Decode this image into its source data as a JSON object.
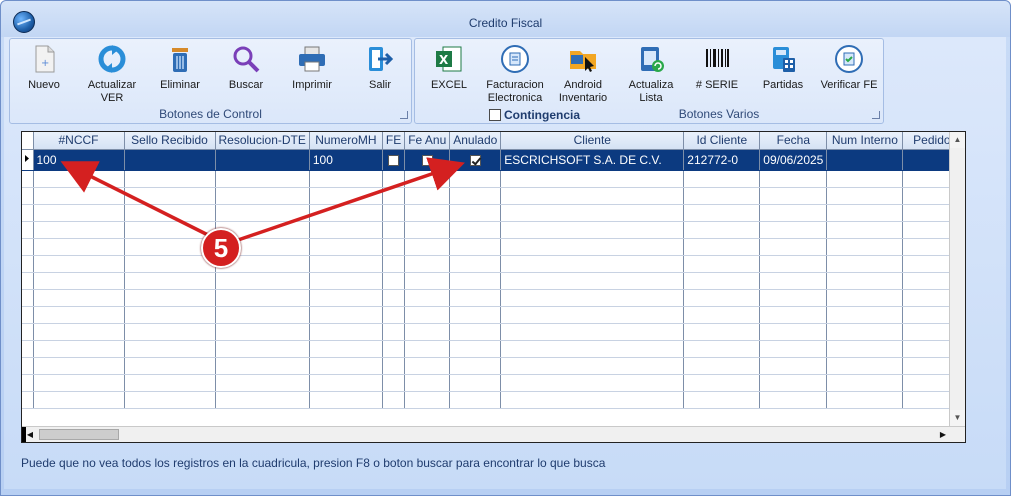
{
  "window": {
    "title": "Credito Fiscal"
  },
  "toolbar": {
    "group1": {
      "label": "Botones de Control",
      "buttons": [
        {
          "label": "Nuevo"
        },
        {
          "label": "Actualizar\nVER"
        },
        {
          "label": "Eliminar"
        },
        {
          "label": "Buscar"
        },
        {
          "label": "Imprimir"
        },
        {
          "label": "Salir"
        }
      ]
    },
    "group2": {
      "label": "Botones Varios",
      "contingencia_label": "Contingencia",
      "contingencia_checked": false,
      "buttons": [
        {
          "label": "EXCEL"
        },
        {
          "label": "Facturacion\nElectronica"
        },
        {
          "label": "Android\nInventario"
        },
        {
          "label": "Actualiza\nLista"
        },
        {
          "label": "# SERIE"
        },
        {
          "label": "Partidas"
        },
        {
          "label": "Verificar FE"
        }
      ]
    }
  },
  "grid": {
    "columns": [
      "#NCCF",
      "Sello Recibido",
      "Resolucion-DTE",
      "NumeroMH",
      "FE",
      "Fe Anu",
      "Anulado",
      "Cliente",
      "Id Cliente",
      "Fecha",
      "Num Interno",
      "Pedido"
    ],
    "rows": [
      {
        "nccf": "100",
        "sello": "",
        "resolucion": "",
        "numero_mh": "100",
        "fe": false,
        "fe_anu": false,
        "anulado": true,
        "cliente": "ESCRICHSOFT S.A. DE C.V.",
        "id_cliente": "212772-0",
        "fecha": "09/06/2025",
        "num_interno": "",
        "pedido": ""
      }
    ]
  },
  "annotation": {
    "badge": "5",
    "color": "#d42020"
  },
  "status": {
    "text": "Puede que no vea todos los registros en la cuadricula, presion F8 o boton buscar para encontrar lo que busca"
  },
  "colors": {
    "selected_row": "#0c3a80",
    "window_bg": "#c7dbf7",
    "arrow": "#d42020"
  }
}
